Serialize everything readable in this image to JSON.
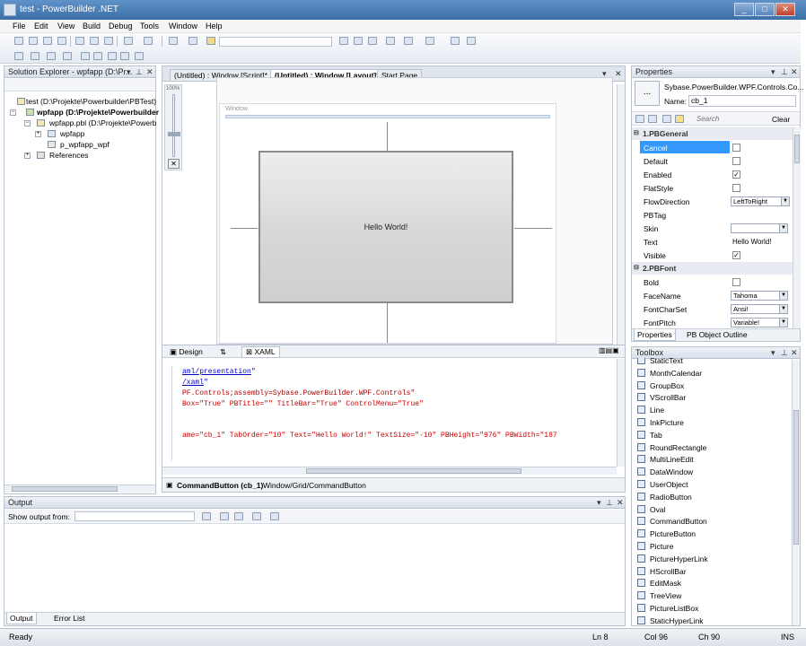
{
  "window": {
    "title": "test - PowerBuilder .NET",
    "min": "_",
    "max": "□",
    "close": "✕"
  },
  "menu": [
    "File",
    "Edit",
    "View",
    "Build",
    "Debug",
    "Tools",
    "Window",
    "Help"
  ],
  "solution_explorer": {
    "title": "Solution Explorer - wpfapp (D:\\Pr...",
    "items": [
      "test (D:\\Projekte\\Powerbuilder\\PBTest)",
      "wpfapp (D:\\Projekte\\Powerbuilder",
      "wpfapp.pbl (D:\\Projekte\\Powerb",
      "wpfapp",
      "p_wpfapp_wpf",
      "References"
    ]
  },
  "doc_tabs": [
    "(Untitled) : Window [Script]*",
    "(Untitled) : Window [Layout]*",
    "Start Page"
  ],
  "designer": {
    "zoom": "100%",
    "window_label": "Window",
    "button_text": "Hello World!"
  },
  "bottom_tabs": {
    "design": "Design",
    "swap": "⇅",
    "xaml": "XAML"
  },
  "code_lines": [
    {
      "t": "aml/presentation",
      "s": "\""
    },
    {
      "t": "/xaml",
      "s": "\""
    },
    {
      "t": "PF.Controls;assembly=Sybase.PowerBuilder.WPF.Controls\""
    },
    {
      "a": "Box=\"True\" PBTitle=\"\" TitleBar=\"True\" ControlMenu=\"True\""
    },
    {
      "a": "ame=\"cb_1\" TabOrder=\"10\" Text=\"Hello World!\" TextSize=\"-10\" PBHeight=\"976\" PBWidth=\"187"
    }
  ],
  "breadcrumb": {
    "control": "CommandButton (cb_1)",
    "path": "Window/Grid/CommandButton"
  },
  "properties": {
    "title": "Properties",
    "type": "Sybase.PowerBuilder.WPF.Controls.Co...",
    "name_label": "Name:",
    "name_value": "cb_1",
    "search_placeholder": "Search",
    "clear": "Clear",
    "cat1": "1.PBGeneral",
    "rows1": [
      {
        "n": "Cancel",
        "v": "",
        "kind": "check",
        "checked": false,
        "sel": true
      },
      {
        "n": "Default",
        "v": "",
        "kind": "check",
        "checked": false
      },
      {
        "n": "Enabled",
        "v": "",
        "kind": "check",
        "checked": true
      },
      {
        "n": "FlatStyle",
        "v": "",
        "kind": "check",
        "checked": false
      },
      {
        "n": "FlowDirection",
        "v": "LeftToRight",
        "kind": "dd"
      },
      {
        "n": "PBTag",
        "v": "",
        "kind": "text"
      },
      {
        "n": "Skin",
        "v": "",
        "kind": "dd"
      },
      {
        "n": "Text",
        "v": "Hello World!",
        "kind": "text"
      },
      {
        "n": "Visible",
        "v": "",
        "kind": "check",
        "checked": true
      }
    ],
    "cat2": "2.PBFont",
    "rows2": [
      {
        "n": "Bold",
        "v": "",
        "kind": "check",
        "checked": false
      },
      {
        "n": "FaceName",
        "v": "Tahoma",
        "kind": "dd"
      },
      {
        "n": "FontCharSet",
        "v": "Ansi!",
        "kind": "dd"
      },
      {
        "n": "FontPitch",
        "v": "Variable!",
        "kind": "dd"
      }
    ],
    "tabs": [
      "Properties",
      "PB Object Outline"
    ]
  },
  "toolbox": {
    "title": "Toolbox",
    "items": [
      "StaticText",
      "MonthCalendar",
      "GroupBox",
      "VScrollBar",
      "Line",
      "InkPicture",
      "Tab",
      "RoundRectangle",
      "MultiLineEdit",
      "DataWindow",
      "UserObject",
      "RadioButton",
      "Oval",
      "CommandButton",
      "PictureButton",
      "Picture",
      "PictureHyperLink",
      "HScrollBar",
      "EditMask",
      "TreeView",
      "PictureListBox",
      "StaticHyperLink"
    ]
  },
  "output": {
    "title": "Output",
    "show_from": "Show output from:",
    "tabs": [
      "Output",
      "Error List"
    ]
  },
  "status": {
    "ready": "Ready",
    "ln": "Ln 8",
    "col": "Col 96",
    "ch": "Ch 90",
    "ins": "INS"
  }
}
